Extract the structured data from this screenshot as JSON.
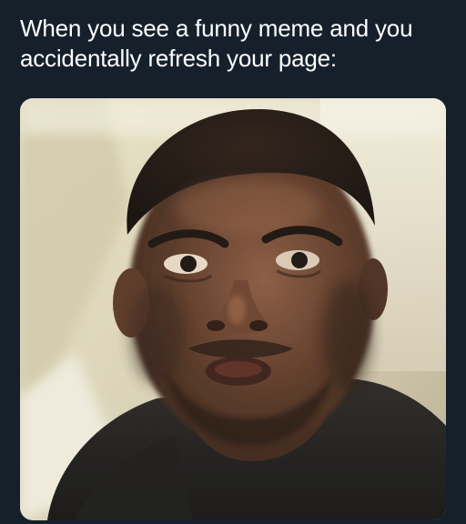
{
  "post": {
    "caption": "When you see a funny meme and you accidentally refresh your page:"
  },
  "colors": {
    "background": "#15202b",
    "text": "#ffffff"
  }
}
